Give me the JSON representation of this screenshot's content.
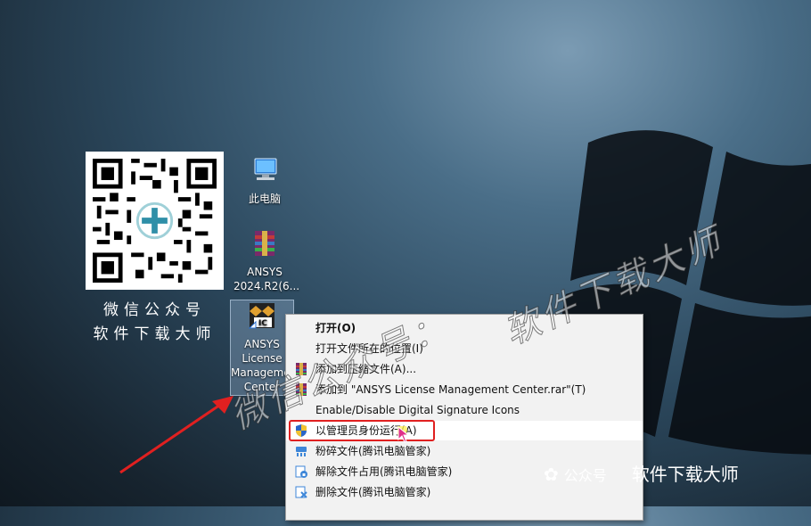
{
  "desktop": {
    "icons": [
      {
        "label": "此电脑"
      },
      {
        "label": "ANSYS 2024.R2(6..."
      },
      {
        "label": "ANSYS License Management Center"
      }
    ],
    "qr_caption_line1": "微信公众号",
    "qr_caption_line2": "软件下载大师"
  },
  "context_menu": {
    "items": [
      {
        "label": "打开(O)",
        "icon": "none"
      },
      {
        "label": "打开文件所在的位置(I)",
        "icon": "none"
      },
      {
        "label": "添加到压缩文件(A)...",
        "icon": "winrar-icon"
      },
      {
        "label": "添加到 \"ANSYS License Management Center.rar\"(T)",
        "icon": "winrar-icon"
      },
      {
        "label": "Enable/Disable Digital Signature Icons",
        "icon": "none"
      },
      {
        "label": "以管理员身份运行(A)",
        "icon": "uac-shield-icon"
      },
      {
        "label": "粉碎文件(腾讯电脑管家)",
        "icon": "shred-icon"
      },
      {
        "label": "解除文件占用(腾讯电脑管家)",
        "icon": "unlock-icon"
      },
      {
        "label": "删除文件(腾讯电脑管家)",
        "icon": "delete-icon"
      }
    ]
  },
  "watermark": {
    "text_a": "微信公众号：",
    "text_b": "软件下载大师"
  },
  "brand": {
    "prefix": "公众号",
    "name": "软件下载大师"
  },
  "colors": {
    "highlight_box": "#e02020",
    "menu_bg": "#f2f2f2"
  }
}
